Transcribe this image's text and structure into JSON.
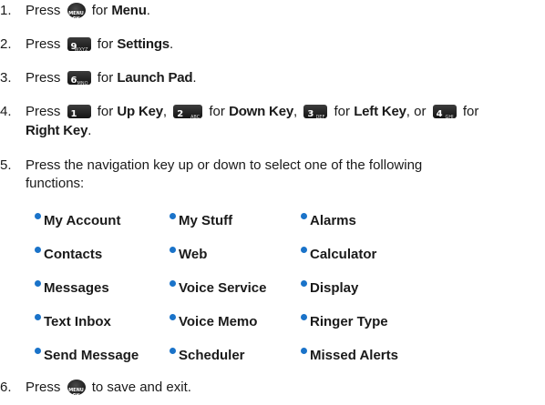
{
  "menu_key": {
    "line1": "MENU",
    "line2": "OK"
  },
  "steps": {
    "s1": {
      "num": "1.",
      "press": "Press",
      "for": "for",
      "target": "Menu",
      "end": "."
    },
    "s2": {
      "num": "2.",
      "press": "Press",
      "key_digit": "9",
      "key_letters": "WXYZ",
      "for": "for",
      "target": "Settings",
      "end": "."
    },
    "s3": {
      "num": "3.",
      "press": "Press",
      "key_digit": "6",
      "key_letters": "MNO",
      "for": "for",
      "target": "Launch Pad",
      "end": "."
    },
    "s4": {
      "num": "4.",
      "press": "Press",
      "k1": {
        "digit": "1",
        "letters": "",
        "target": "Up Key"
      },
      "k2": {
        "digit": "2",
        "letters": "ABC",
        "target": "Down Key"
      },
      "k3": {
        "digit": "3",
        "letters": "DEF",
        "target": "Left Key"
      },
      "k4": {
        "digit": "4",
        "letters": "GHI",
        "target": "Right Key"
      },
      "for": "for",
      "or": "or",
      "comma": ",",
      "end": "."
    },
    "s5": {
      "num": "5.",
      "line1": "Press the navigation key up or down to select one of the following",
      "line2": "functions:"
    },
    "s6": {
      "num": "6.",
      "press": "Press",
      "rest": "to save and exit."
    }
  },
  "functions": [
    [
      "My Account",
      "My Stuff",
      "Alarms"
    ],
    [
      "Contacts",
      "Web",
      "Calculator"
    ],
    [
      "Messages",
      "Voice Service",
      "Display"
    ],
    [
      "Text Inbox",
      "Voice Memo",
      "Ringer Type"
    ],
    [
      "Send Message",
      "Scheduler",
      "Missed Alerts"
    ]
  ],
  "colors": {
    "bullet": "#1a73c9",
    "text": "#1a1a1a"
  }
}
